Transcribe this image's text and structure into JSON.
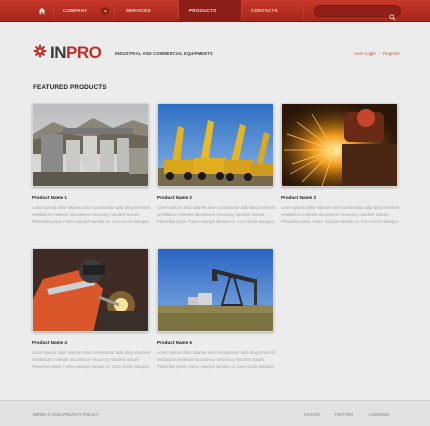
{
  "nav": {
    "home_icon": "home-icon",
    "items": [
      {
        "label": "COMPANY",
        "active": false
      },
      {
        "label": "SERVICES",
        "active": false
      },
      {
        "label": "PRODUCTS",
        "active": true
      },
      {
        "label": "CONTACTS",
        "active": false
      }
    ],
    "dropdown_icon": "chevron-down-icon",
    "search_placeholder": "",
    "search_icon": "search-icon"
  },
  "header": {
    "logo_icon": "gear-icon",
    "logo_part1": "IN",
    "logo_part2": "PRO",
    "tagline": "INDUSTRIAL AND COMMERCIAL EQUIPMENTS",
    "user_login": "User Login",
    "user_sep": "/",
    "register": "Register"
  },
  "main": {
    "section_title": "FEATURED PRODUCTS",
    "products": [
      {
        "name": "Product Name 1",
        "desc": "Lorem ipsum dolor sitamet amet consectetur adip ding etrectent vestibulum molestie lacusmeun necuency handerit mauris. Phasellus porta. Fusce suscipit variuss mi. Cum sociis natoque."
      },
      {
        "name": "Product Name 2",
        "desc": "Lorem ipsum dolor sitamet amet consectetur adip ding etrectent vestibulum molestie lacusmeun necuency handerit mauris. Phasellus porta. Fusce suscipit variuss mi. Cum sociis natoque."
      },
      {
        "name": "Product Name 3",
        "desc": "Lorem ipsum dolor sitamet amet consectetur adip ding etrectent vestibulum molestie lacusmeun necuency handerit mauris. Phasellus porta. Fusce suscipit variuss mi. Cum sociis natoque."
      },
      {
        "name": "Product Name 4",
        "desc": "Lorem ipsum dolor sitamet amet consectetur adip ding etrectent vestibulum molestie lacusmeun necuency handerit mauris. Phasellus porta. Fusce suscipit variuss mi. Cum sociis natoque."
      },
      {
        "name": "Product Name 5",
        "desc": "Lorem ipsum dolor sitamet amet consectetur adip ding etrectent vestibulum molestie lacusmeun necuency handerit mauris. Phasellus porta. Fusce suscipit variuss mi. Cum sociis natoque."
      }
    ]
  },
  "footer": {
    "copyright": "INPRO © 2012 PRIVACY POLICY",
    "links": [
      "FLICKR",
      "TWITTER",
      "LINKEDIN"
    ]
  },
  "colors": {
    "brand_red": "#c0302a",
    "nav_active": "#8c1f16",
    "background": "#ececec"
  }
}
